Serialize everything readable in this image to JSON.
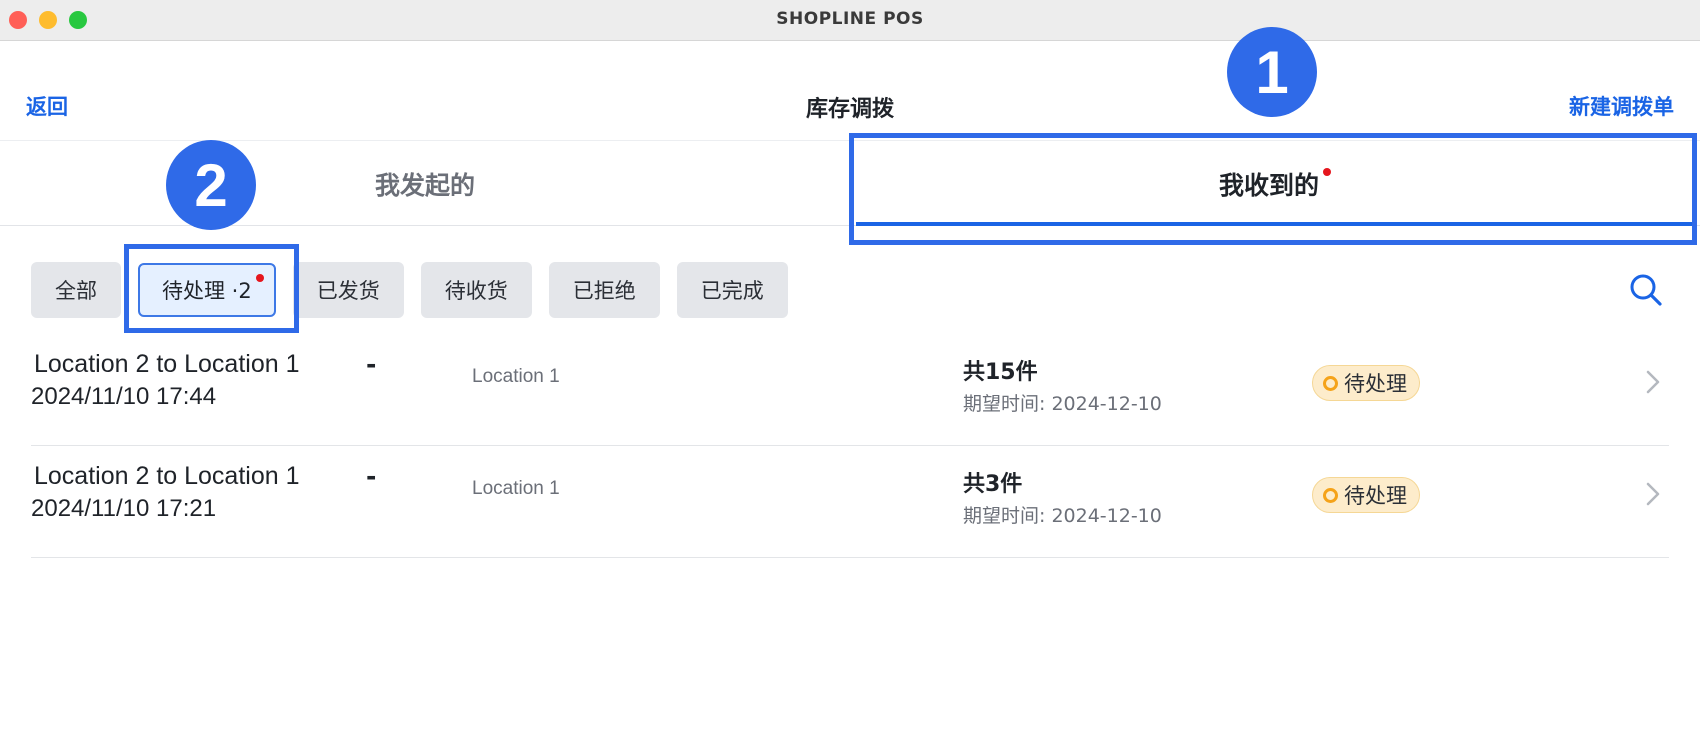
{
  "window": {
    "title": "SHOPLINE POS"
  },
  "navbar": {
    "back_label": "返回",
    "title": "库存调拨",
    "new_label": "新建调拨单"
  },
  "tabs": [
    {
      "label": "我发起的",
      "active": false,
      "has_dot": false
    },
    {
      "label": "我收到的",
      "active": true,
      "has_dot": true
    }
  ],
  "filters": [
    {
      "label": "全部",
      "active": false
    },
    {
      "label": "待处理 ·2",
      "active": true
    },
    {
      "label": "已发货",
      "active": false
    },
    {
      "label": "待收货",
      "active": false
    },
    {
      "label": "已拒绝",
      "active": false
    },
    {
      "label": "已完成",
      "active": false
    }
  ],
  "search_icon": "search-icon",
  "annotations": [
    {
      "number": "1"
    },
    {
      "number": "2"
    }
  ],
  "rows": [
    {
      "route": "Location 2 to Location 1",
      "datetime": "2024/11/10 17:44",
      "dash": "-",
      "location": "Location 1",
      "quantity": "共15件",
      "expected": "期望时间: 2024-12-10",
      "status": "待处理"
    },
    {
      "route": "Location 2 to Location 1",
      "datetime": "2024/11/10 17:21",
      "dash": "-",
      "location": "Location 1",
      "quantity": "共3件",
      "expected": "期望时间: 2024-12-10",
      "status": "待处理"
    }
  ],
  "colors": {
    "accent": "#1a64e5",
    "annotation": "#2f6ae8",
    "status_bg": "#fdeccb",
    "status_ring": "#f5a31a",
    "notify_dot": "#e5161d"
  }
}
